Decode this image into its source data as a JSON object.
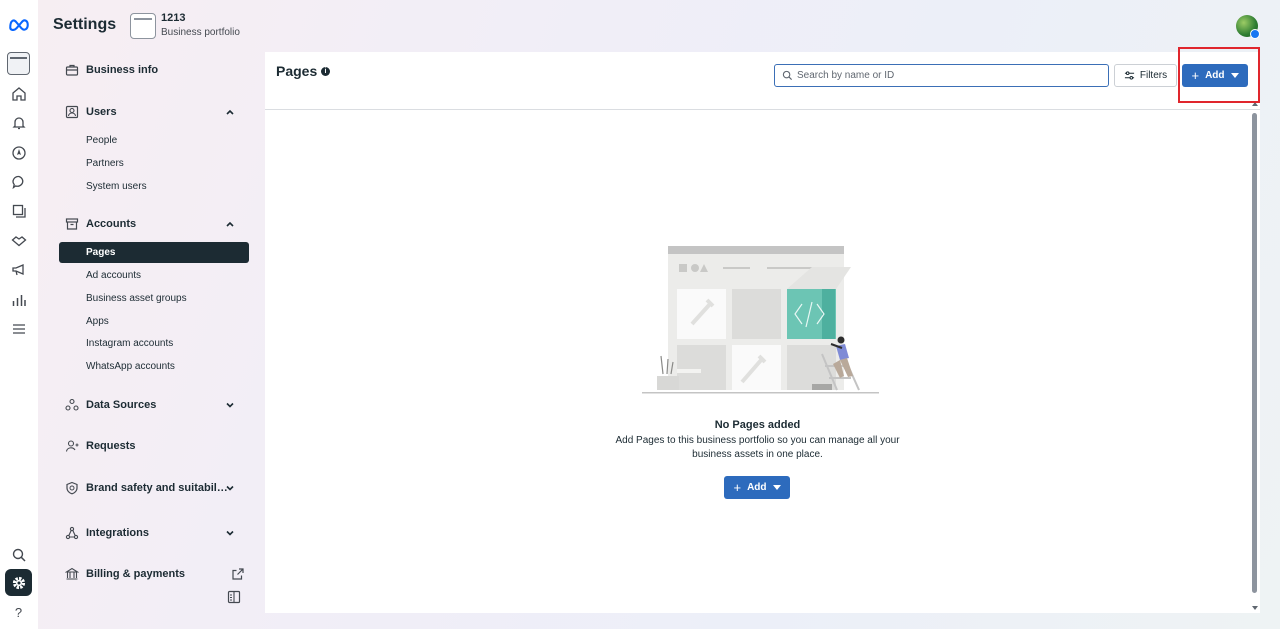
{
  "header": {
    "title": "Settings",
    "portfolio_name": "1213",
    "portfolio_sub": "Business portfolio"
  },
  "rail": {
    "icons": [
      "meta-logo-icon",
      "portfolio-icon",
      "home-icon",
      "bell-icon",
      "compass-icon",
      "chat-icon",
      "pages-stack-icon",
      "handshake-icon",
      "megaphone-icon",
      "bar-chart-icon",
      "menu-icon",
      "search-icon",
      "gear-icon",
      "help-icon"
    ]
  },
  "sidebar": {
    "business_info": "Business info",
    "users": {
      "label": "Users",
      "items": [
        "People",
        "Partners",
        "System users"
      ]
    },
    "accounts": {
      "label": "Accounts",
      "active": "Pages",
      "items": [
        "Ad accounts",
        "Business asset groups",
        "Apps",
        "Instagram accounts",
        "WhatsApp accounts"
      ]
    },
    "data_sources": "Data Sources",
    "requests": "Requests",
    "brand_safety": "Brand safety and suitabil…",
    "integrations": "Integrations",
    "billing": "Billing & payments"
  },
  "main": {
    "title": "Pages",
    "search_placeholder": "Search by name or ID",
    "filters_label": "Filters",
    "add_label": "Add",
    "empty_title": "No Pages added",
    "empty_desc": "Add Pages to this business portfolio so you can manage all your business assets in one place.",
    "empty_add_label": "Add"
  },
  "colors": {
    "accent": "#2d6bbd",
    "active_nav": "#1c2b33",
    "highlight_box": "#e0262d"
  }
}
